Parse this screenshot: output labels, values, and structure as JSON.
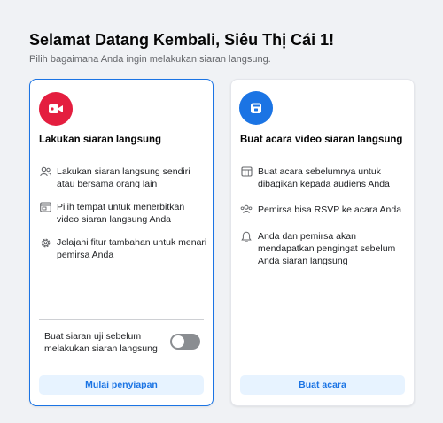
{
  "header": {
    "title": "Selamat Datang Kembali, Siêu Thị Cái 1!",
    "subtitle": "Pilih bagaimana Anda ingin melakukan siaran langsung."
  },
  "cards": [
    {
      "title": "Lakukan siaran langsung",
      "hero_icon": "video-camera-icon",
      "hero_color": "#e41e3f",
      "features": [
        {
          "icon": "people-icon",
          "text": "Lakukan siaran langsung sendiri atau bersama orang lain"
        },
        {
          "icon": "browser-window-icon",
          "text": "Pilih tempat untuk menerbitkan video siaran langsung Anda"
        },
        {
          "icon": "gear-icon",
          "text": "Jelajahi fitur tambahan untuk menari pemirsa Anda"
        }
      ],
      "toggle_label": "Buat siaran uji sebelum melakukan siaran langsung",
      "toggle_on": false,
      "button_label": "Mulai penyiapan"
    },
    {
      "title": "Buat acara video siaran langsung",
      "hero_icon": "calendar-icon",
      "hero_color": "#1b74e4",
      "features": [
        {
          "icon": "calendar-grid-icon",
          "text": "Buat acara sebelumnya untuk dibagikan kepada audiens Anda"
        },
        {
          "icon": "group-icon",
          "text": "Pemirsa bisa RSVP ke acara Anda"
        },
        {
          "icon": "bell-icon",
          "text": "Anda dan pemirsa akan mendapatkan pengingat sebelum Anda siaran langsung"
        }
      ],
      "button_label": "Buat acara"
    }
  ],
  "colors": {
    "accent": "#1b74e4",
    "live_red": "#e41e3f",
    "button_bg": "#e7f3ff",
    "page_bg": "#f0f2f5"
  }
}
